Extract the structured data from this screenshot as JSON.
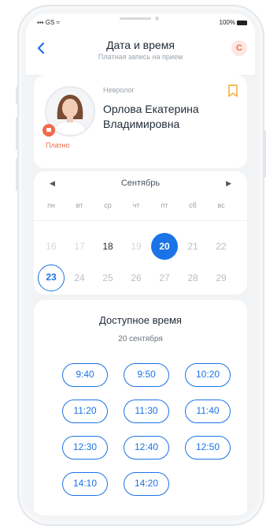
{
  "status": {
    "carrier": "GS",
    "battery": "100%"
  },
  "header": {
    "title": "Дата и время",
    "subtitle": "Платная запись на прием",
    "avatar_letter": "C"
  },
  "doctor": {
    "specialty": "Невролог",
    "name_line1": "Орлова Екатерина",
    "name_line2": "Владимировна",
    "payment": "Платно"
  },
  "calendar": {
    "month": "Сентябрь",
    "weekdays": [
      "пн",
      "вт",
      "ср",
      "чт",
      "пт",
      "сб",
      "вс"
    ],
    "week1": [
      "16",
      "17",
      "18",
      "19",
      "20",
      "21",
      "22"
    ],
    "week2": [
      "23",
      "24",
      "25",
      "26",
      "27",
      "28",
      "29"
    ]
  },
  "times": {
    "title": "Доступное время",
    "date": "20 сентября",
    "slots": [
      "9:40",
      "9:50",
      "10:20",
      "11:20",
      "11:30",
      "11:40",
      "12:30",
      "12:40",
      "12:50",
      "14:10",
      "14:20"
    ]
  },
  "colors": {
    "accent": "#1b73e8",
    "paid": "#f26b4b",
    "bookmark": "#f5a623"
  }
}
